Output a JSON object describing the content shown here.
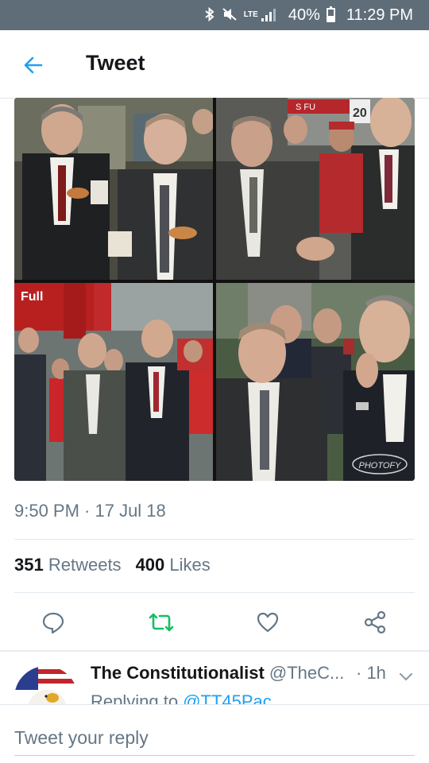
{
  "status_bar": {
    "lte": "LTE",
    "battery": "40%",
    "battery_level": 0.4,
    "time": "11:29 PM",
    "icons": [
      "bluetooth-icon",
      "mute-icon",
      "signal-icon",
      "battery-icon"
    ]
  },
  "header": {
    "title": "Tweet",
    "back_icon": "back-arrow-icon"
  },
  "media": {
    "photos": [
      {
        "name": "photo-top-left"
      },
      {
        "name": "photo-top-right",
        "sign_text": "S FU",
        "sign_number": "20"
      },
      {
        "name": "photo-bottom-left",
        "sign_text": "Full"
      },
      {
        "name": "photo-bottom-right",
        "watermark": "PHOTOFY"
      }
    ]
  },
  "tweet": {
    "timestamp": "9:50 PM · 17 Jul 18",
    "retweets_count": "351",
    "retweets_label": "Retweets",
    "likes_count": "400",
    "likes_label": "Likes"
  },
  "actions": {
    "reply_icon": "reply-icon",
    "retweet_icon": "retweet-icon",
    "like_icon": "heart-icon",
    "share_icon": "share-icon",
    "retweet_color": "#17bf63",
    "icon_color": "#657786"
  },
  "reply": {
    "name": "The Constitutionalist",
    "handle": "@TheC...",
    "time": "· 1h",
    "replying_label": "Replying to",
    "mention": "@TT45Pac"
  },
  "compose": {
    "placeholder": "Tweet your reply"
  },
  "colors": {
    "status_bar": "#5f6d79",
    "accent": "#1da1f2",
    "muted": "#657786"
  }
}
